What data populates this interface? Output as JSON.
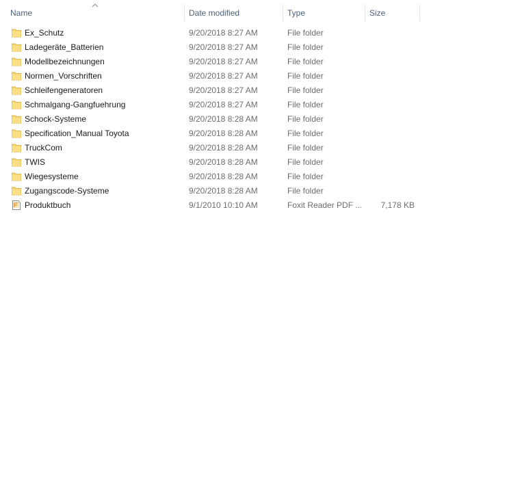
{
  "columns": {
    "name": "Name",
    "date": "Date modified",
    "type": "Type",
    "size": "Size"
  },
  "sort": {
    "column": "name",
    "direction": "ascending"
  },
  "files": [
    {
      "name": "Ex_Schutz",
      "date": "9/20/2018 8:27 AM",
      "type": "File folder",
      "size": "",
      "icon": "folder-icon"
    },
    {
      "name": "Ladegeräte_Batterien",
      "date": "9/20/2018 8:27 AM",
      "type": "File folder",
      "size": "",
      "icon": "folder-icon"
    },
    {
      "name": "Modellbezeichnungen",
      "date": "9/20/2018 8:27 AM",
      "type": "File folder",
      "size": "",
      "icon": "folder-icon"
    },
    {
      "name": "Normen_Vorschriften",
      "date": "9/20/2018 8:27 AM",
      "type": "File folder",
      "size": "",
      "icon": "folder-icon"
    },
    {
      "name": "Schleifengeneratoren",
      "date": "9/20/2018 8:27 AM",
      "type": "File folder",
      "size": "",
      "icon": "folder-icon"
    },
    {
      "name": "Schmalgang-Gangfuehrung",
      "date": "9/20/2018 8:27 AM",
      "type": "File folder",
      "size": "",
      "icon": "folder-icon"
    },
    {
      "name": "Schock-Systeme",
      "date": "9/20/2018 8:28 AM",
      "type": "File folder",
      "size": "",
      "icon": "folder-icon"
    },
    {
      "name": "Specification_Manual Toyota",
      "date": "9/20/2018 8:28 AM",
      "type": "File folder",
      "size": "",
      "icon": "folder-icon"
    },
    {
      "name": "TruckCom",
      "date": "9/20/2018 8:28 AM",
      "type": "File folder",
      "size": "",
      "icon": "folder-icon"
    },
    {
      "name": "TWIS",
      "date": "9/20/2018 8:28 AM",
      "type": "File folder",
      "size": "",
      "icon": "folder-icon"
    },
    {
      "name": "Wiegesysteme",
      "date": "9/20/2018 8:28 AM",
      "type": "File folder",
      "size": "",
      "icon": "folder-icon"
    },
    {
      "name": "Zugangscode-Systeme",
      "date": "9/20/2018 8:28 AM",
      "type": "File folder",
      "size": "",
      "icon": "folder-icon"
    },
    {
      "name": "Produktbuch",
      "date": "9/1/2010 10:10 AM",
      "type": "Foxit Reader PDF ...",
      "size": "7,178 KB",
      "icon": "pdf-file-icon"
    }
  ],
  "colors": {
    "header_text": "#4c607a",
    "secondary_text": "#6d6d6d",
    "folder": "#f8d775",
    "folder_dark": "#e0b64a",
    "pdf_accent": "#e8a33d"
  }
}
